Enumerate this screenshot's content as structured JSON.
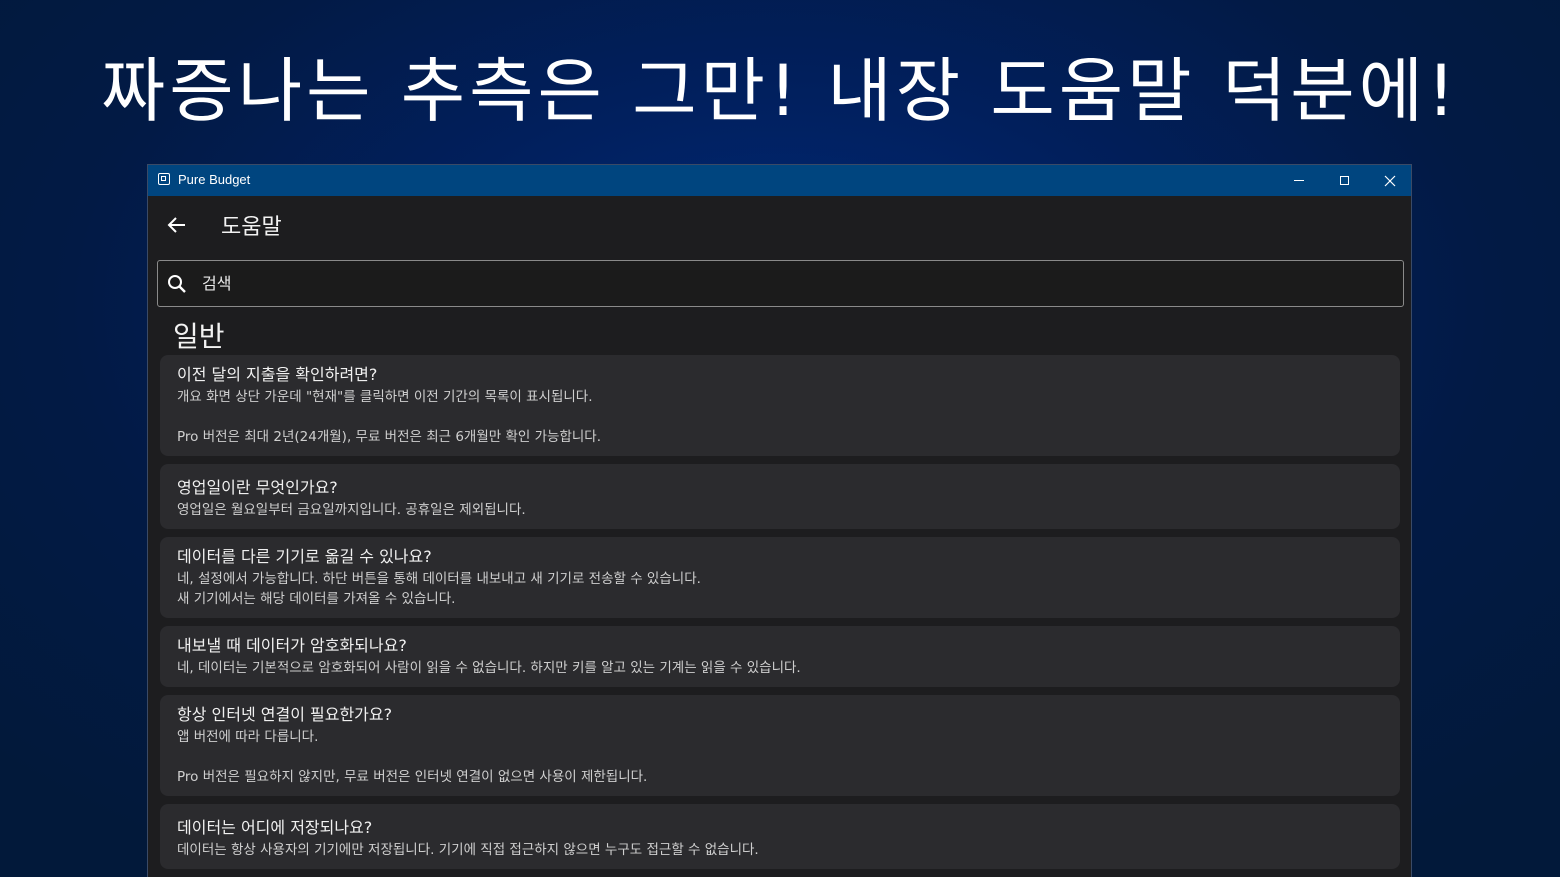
{
  "promo": {
    "headline": "짜증나는 추측은 그만! 내장 도움말 덕분에!"
  },
  "window": {
    "title": "Pure Budget",
    "controls": {
      "minimize_icon": "minimize-icon",
      "maximize_icon": "maximize-icon",
      "close_icon": "close-icon"
    }
  },
  "header": {
    "back_icon": "back-arrow-icon",
    "title": "도움말"
  },
  "search": {
    "placeholder": "검색",
    "value": ""
  },
  "section": {
    "title": "일반"
  },
  "faq": [
    {
      "question": "이전 달의 지출을 확인하려면?",
      "answer": "개요 화면 상단 가운데 \"현재\"를 클릭하면 이전 기간의 목록이 표시됩니다.\n\nPro 버전은 최대 2년(24개월), 무료 버전은 최근 6개월만 확인 가능합니다."
    },
    {
      "question": "영업일이란 무엇인가요?",
      "answer": "영업일은 월요일부터 금요일까지입니다. 공휴일은 제외됩니다."
    },
    {
      "question": "데이터를 다른 기기로 옮길 수 있나요?",
      "answer": "네, 설정에서 가능합니다. 하단 버튼을 통해 데이터를 내보내고 새 기기로 전송할 수 있습니다.\n새 기기에서는 해당 데이터를 가져올 수 있습니다."
    },
    {
      "question": "내보낼 때 데이터가 암호화되나요?",
      "answer": "네, 데이터는 기본적으로 암호화되어 사람이 읽을 수 없습니다. 하지만 키를 알고 있는 기계는 읽을 수 있습니다."
    },
    {
      "question": "항상 인터넷 연결이 필요한가요?",
      "answer": "앱 버전에 따라 다릅니다.\n\nPro 버전은 필요하지 않지만, 무료 버전은 인터넷 연결이 없으면 사용이 제한됩니다."
    },
    {
      "question": "데이터는 어디에 저장되나요?",
      "answer": "데이터는 항상 사용자의 기기에만 저장됩니다. 기기에 직접 접근하지 않으면 누구도 접근할 수 없습니다."
    }
  ],
  "colors": {
    "titlebar": "#00457f",
    "window_background": "#1d1d1f",
    "card_background": "#2b2b2e"
  }
}
